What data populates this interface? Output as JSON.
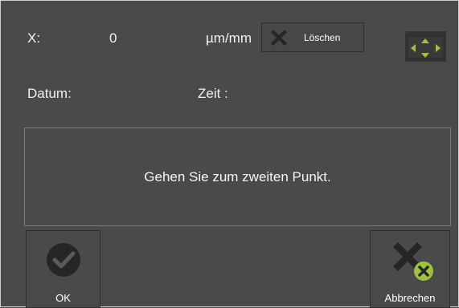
{
  "header": {
    "x_label": "X:",
    "x_value": "0",
    "unit": "µm/mm",
    "clear_label": "Löschen",
    "date_label": "Datum:",
    "time_label": "Zeit :"
  },
  "message": "Gehen Sie zum zweiten Punkt.",
  "buttons": {
    "ok_label": "OK",
    "cancel_label": "Abbrechen"
  },
  "icons": {
    "clear": "x-icon",
    "navigation": "nav-arrows-icon",
    "ok": "check-circle-icon",
    "cancel": "x-circle-icon"
  },
  "colors": {
    "background": "#4a4a4a",
    "accent_green": "#9bc43c",
    "icon_dark": "#262626"
  }
}
